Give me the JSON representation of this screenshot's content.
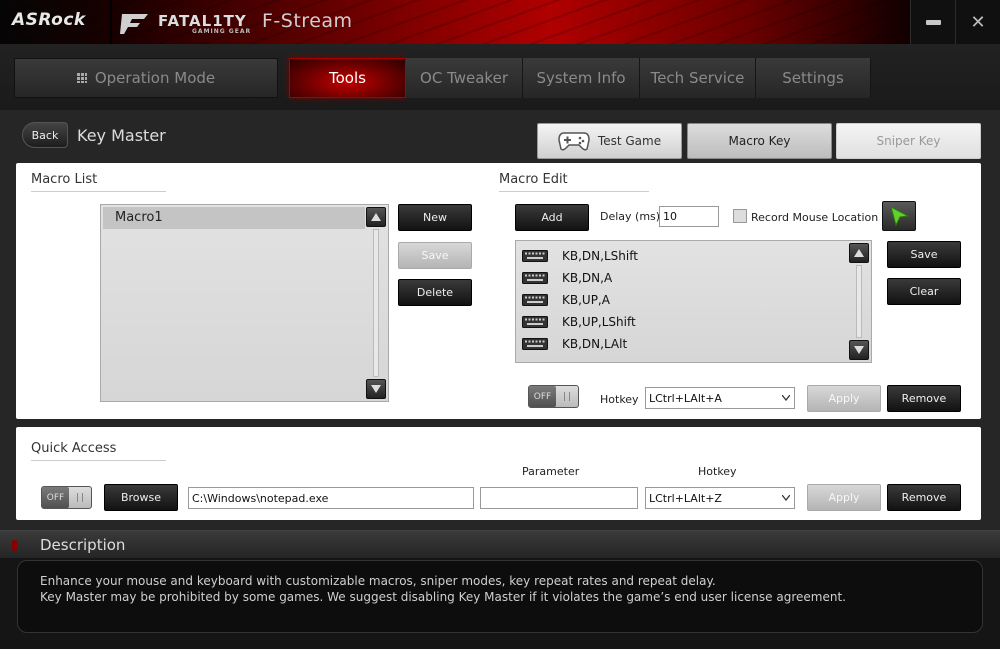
{
  "window": {
    "brand": "ASRock",
    "sub_brand": "FATAL1TY",
    "sub_brand_tag": "GAMING GEAR",
    "title": "F-Stream",
    "minimize_icon": "minimize-icon",
    "close_icon": "close-icon",
    "close_glyph": "✕"
  },
  "nav": {
    "tabs": [
      {
        "label": "Operation Mode",
        "icon": "grid-icon"
      },
      {
        "label": "Tools",
        "active": true
      },
      {
        "label": "OC Tweaker"
      },
      {
        "label": "System Info"
      },
      {
        "label": "Tech Service"
      },
      {
        "label": "Settings"
      }
    ]
  },
  "page": {
    "back_label": "Back",
    "title": "Key Master",
    "modes": {
      "test_game": "Test Game",
      "macro_key": "Macro Key",
      "sniper_key": "Sniper Key"
    }
  },
  "macro_list": {
    "title": "Macro List",
    "items": [
      "Macro1"
    ],
    "new_label": "New",
    "save_label": "Save",
    "delete_label": "Delete"
  },
  "macro_edit": {
    "title": "Macro Edit",
    "add_label": "Add",
    "delay_label": "Delay (ms)",
    "delay_value": "10",
    "record_mouse_label": "Record Mouse Location",
    "record_mouse_checked": false,
    "steps": [
      "KB,DN,LShift",
      "KB,DN,A",
      "KB,UP,A",
      "KB,UP,LShift",
      "KB,DN,LAlt"
    ],
    "save_label": "Save",
    "clear_label": "Clear",
    "toggle_label": "OFF",
    "hotkey_label": "Hotkey",
    "hotkey_value": "LCtrl+LAlt+A",
    "apply_label": "Apply",
    "remove_label": "Remove"
  },
  "quick_access": {
    "title": "Quick Access",
    "toggle_label": "OFF",
    "browse_label": "Browse",
    "path_value": "C:\\Windows\\notepad.exe",
    "parameter_label": "Parameter",
    "parameter_value": "",
    "hotkey_label": "Hotkey",
    "hotkey_value": "LCtrl+LAlt+Z",
    "apply_label": "Apply",
    "remove_label": "Remove"
  },
  "description": {
    "title": "Description",
    "line1": "Enhance your mouse and keyboard with customizable macros, sniper modes, key repeat rates and repeat delay.",
    "line2": "Key Master may be prohibited by some games. We suggest disabling Key Master if it violates the game’s end user license agreement."
  },
  "colors": {
    "accent_red": "#c40000",
    "dark_bg": "#1b1b1b",
    "panel_bg": "#ffffff"
  }
}
